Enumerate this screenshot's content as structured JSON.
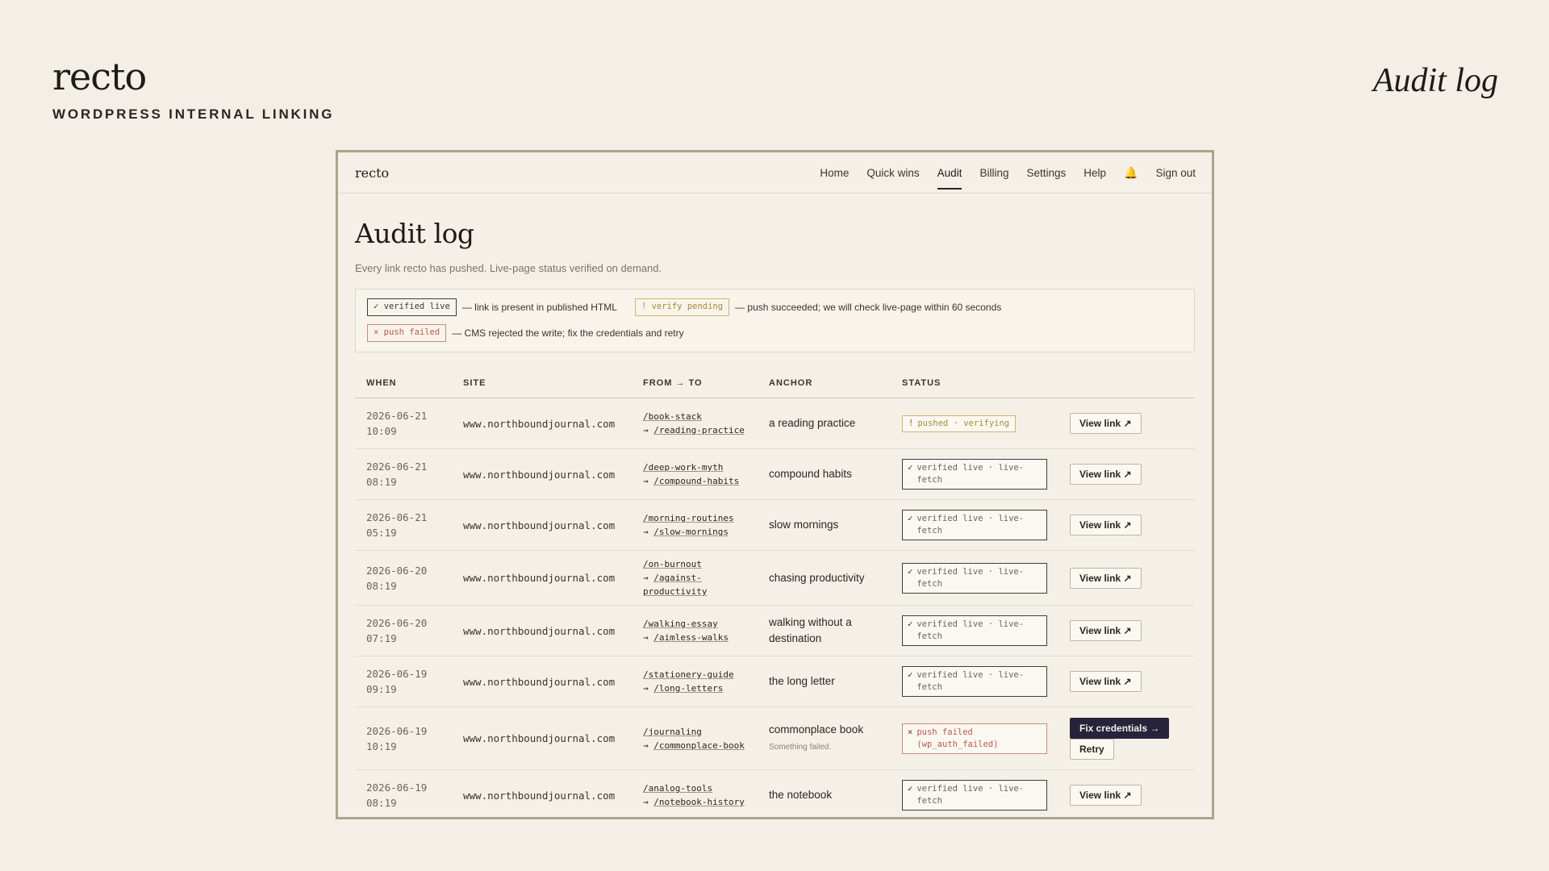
{
  "brand": {
    "name": "recto",
    "tagline": "WORDPRESS INTERNAL LINKING"
  },
  "corner_title": "Audit log",
  "nav": {
    "logo": "recto",
    "links": [
      "Home",
      "Quick wins",
      "Audit",
      "Billing",
      "Settings",
      "Help"
    ],
    "active": "Audit",
    "signout": "Sign out",
    "bell": "bell-icon"
  },
  "page": {
    "title": "Audit log",
    "subtitle": "Every link recto has pushed. Live-page status verified on demand."
  },
  "legend": {
    "live_pill": "✓ verified live",
    "live_desc": "— link is present in published HTML",
    "pending_pill": "! verify pending",
    "pending_desc": "— push succeeded; we will check live-page within 60 seconds",
    "failed_pill": "× push failed",
    "failed_desc": "— CMS rejected the write; fix the credentials and retry"
  },
  "table": {
    "headers": [
      "WHEN",
      "SITE",
      "FROM → TO",
      "ANCHOR",
      "STATUS"
    ],
    "rows": [
      {
        "date": "2026-06-21",
        "time": "10:09",
        "site": "www.northboundjournal.com",
        "from": "/book-stack",
        "to": "/reading-practice",
        "anchor": "a reading practice",
        "anchor_note": "",
        "status": "pushed · verifying",
        "status_type": "pending",
        "actions": [
          "View link ↗"
        ]
      },
      {
        "date": "2026-06-21",
        "time": "08:19",
        "site": "www.northboundjournal.com",
        "from": "/deep-work-myth",
        "to": "/compound-habits",
        "anchor": "compound habits",
        "anchor_note": "",
        "status": "verified live · live-fetch",
        "status_type": "live",
        "actions": [
          "View link ↗"
        ]
      },
      {
        "date": "2026-06-21",
        "time": "05:19",
        "site": "www.northboundjournal.com",
        "from": "/morning-routines",
        "to": "/slow-mornings",
        "anchor": "slow mornings",
        "anchor_note": "",
        "status": "verified live · live-fetch",
        "status_type": "live",
        "actions": [
          "View link ↗"
        ]
      },
      {
        "date": "2026-06-20",
        "time": "08:19",
        "site": "www.northboundjournal.com",
        "from": "/on-burnout",
        "to": "/against-productivity",
        "anchor": "chasing productivity",
        "anchor_note": "",
        "status": "verified live · live-fetch",
        "status_type": "live",
        "actions": [
          "View link ↗"
        ]
      },
      {
        "date": "2026-06-20",
        "time": "07:19",
        "site": "www.northboundjournal.com",
        "from": "/walking-essay",
        "to": "/aimless-walks",
        "anchor": "walking without a destination",
        "anchor_note": "",
        "status": "verified live · live-fetch",
        "status_type": "live",
        "actions": [
          "View link ↗"
        ]
      },
      {
        "date": "2026-06-19",
        "time": "09:19",
        "site": "www.northboundjournal.com",
        "from": "/stationery-guide",
        "to": "/long-letters",
        "anchor": "the long letter",
        "anchor_note": "",
        "status": "verified live · live-fetch",
        "status_type": "live",
        "actions": [
          "View link ↗"
        ]
      },
      {
        "date": "2026-06-19",
        "time": "10:19",
        "site": "www.northboundjournal.com",
        "from": "/journaling",
        "to": "/commonplace-book",
        "anchor": "commonplace book",
        "anchor_note": "Something failed.",
        "status": "push failed (wp_auth_failed)",
        "status_type": "failed",
        "actions": [
          "Fix credentials →",
          "Retry"
        ]
      },
      {
        "date": "2026-06-19",
        "time": "08:19",
        "site": "www.northboundjournal.com",
        "from": "/analog-tools",
        "to": "/notebook-history",
        "anchor": "the notebook",
        "anchor_note": "",
        "status": "verified live · live-fetch",
        "status_type": "live",
        "actions": [
          "View link ↗"
        ]
      }
    ]
  },
  "icons": {
    "arrow_prefix": "→",
    "live": "✓",
    "pending": "!",
    "failed": "×"
  }
}
